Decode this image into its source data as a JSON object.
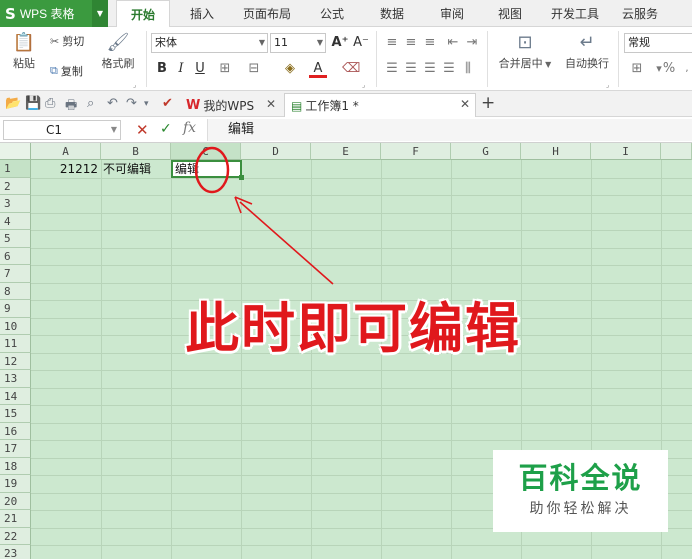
{
  "app": {
    "logo": "S",
    "name": "WPS 表格"
  },
  "menu": {
    "tabs": [
      {
        "label": "开始",
        "active": true
      },
      {
        "label": "插入"
      },
      {
        "label": "页面布局"
      },
      {
        "label": "公式"
      },
      {
        "label": "数据"
      },
      {
        "label": "审阅"
      },
      {
        "label": "视图"
      },
      {
        "label": "开发工具"
      },
      {
        "label": "云服务"
      }
    ]
  },
  "ribbon": {
    "paste": "粘贴",
    "cut": "剪切",
    "copy": "复制",
    "format_painter": "格式刷",
    "font_name": "宋体",
    "font_size": "11",
    "bold": "B",
    "italic": "I",
    "underline": "U",
    "merge_center": "合并居中",
    "wrap_text": "自动换行",
    "number_format": "常规",
    "percent": "%"
  },
  "doc_tabs": [
    {
      "label": "我的WPS",
      "active": false
    },
    {
      "label": "工作簿1 *",
      "active": true
    }
  ],
  "formula_bar": {
    "cell_ref": "C1",
    "fx": "fx",
    "content": "编辑"
  },
  "grid": {
    "columns": [
      "A",
      "B",
      "C",
      "D",
      "E",
      "F",
      "G",
      "H",
      "I"
    ],
    "rows": [
      "1",
      "2",
      "3",
      "4",
      "5",
      "6",
      "7",
      "8",
      "9",
      "10",
      "11",
      "12",
      "13",
      "14",
      "15",
      "16",
      "17",
      "18",
      "19",
      "20",
      "21",
      "22",
      "23"
    ],
    "cells": {
      "A1": "21212",
      "B1": "不可编辑",
      "C1": "编辑"
    },
    "active_cell": "C1"
  },
  "annotation": {
    "text": "此时即可编辑",
    "color": "#e0181c"
  },
  "watermark": {
    "title": "百科全说",
    "subtitle": "助你轻松解决"
  },
  "colors": {
    "accent": "#3b9a3f",
    "grid_bg": "#cce8cf"
  }
}
